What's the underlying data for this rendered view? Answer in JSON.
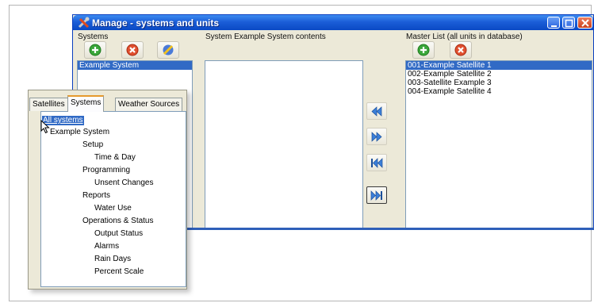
{
  "window": {
    "title": "Manage - systems and units",
    "title_icon": "tools-icon",
    "controls": [
      "minimize-icon",
      "maximize-icon",
      "close-icon"
    ]
  },
  "systems": {
    "label": "Systems",
    "toolbar_icons": [
      "add-icon",
      "delete-icon",
      "edit-icon"
    ],
    "items": [
      "Example System"
    ],
    "selected": "Example System"
  },
  "contents": {
    "label": "System Example System contents",
    "items": []
  },
  "transfer_buttons": [
    "move-left-icon",
    "move-right-icon",
    "move-all-left-icon",
    "move-all-right-icon"
  ],
  "master": {
    "label": "Master List (all units in database)",
    "toolbar_icons": [
      "add-icon",
      "delete-icon"
    ],
    "items": [
      "001-Example Satellite 1",
      "002-Example Satellite 2",
      "003-Satellite Example 3",
      "004-Example Satellite 4"
    ],
    "selected": "001-Example Satellite 1"
  },
  "panel": {
    "tabs": [
      "Satellites",
      "Systems",
      "Weather Sources"
    ],
    "active_tab": "Systems",
    "tree": [
      {
        "label": "All systems",
        "level": 0,
        "selected": true
      },
      {
        "label": "Example System",
        "level": 1
      },
      {
        "label": "Setup",
        "level": 2
      },
      {
        "label": "Time & Day",
        "level": 3
      },
      {
        "label": "Programming",
        "level": 2
      },
      {
        "label": "Unsent Changes",
        "level": 3
      },
      {
        "label": "Reports",
        "level": 2
      },
      {
        "label": "Water Use",
        "level": 3
      },
      {
        "label": "Operations & Status",
        "level": 2
      },
      {
        "label": "Output Status",
        "level": 3
      },
      {
        "label": "Alarms",
        "level": 3
      },
      {
        "label": "Rain Days",
        "level": 3
      },
      {
        "label": "Percent Scale",
        "level": 3
      }
    ]
  },
  "colors": {
    "title_bar": "#1b5ed8",
    "selection": "#316ac5",
    "window_bg": "#ece9d8",
    "tab_highlight": "#e69a2d"
  }
}
